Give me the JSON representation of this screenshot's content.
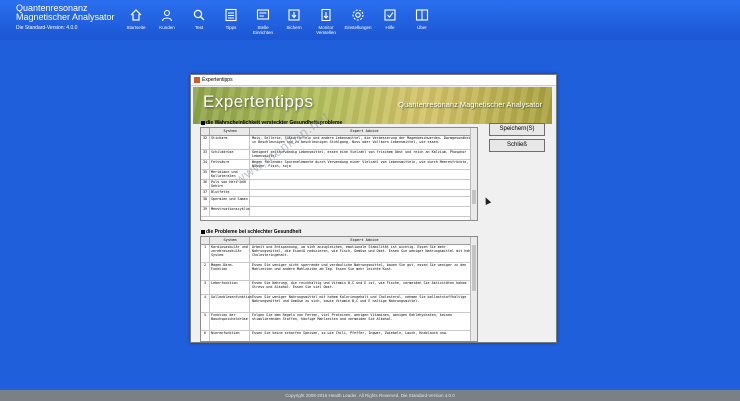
{
  "app": {
    "title_line1": "Quantenresonanz",
    "title_line2": "Magnetischer Analysator",
    "version": "Die Standard-Version: 4.0.0"
  },
  "toolbar": [
    {
      "label": "Startseite",
      "icon": "home-icon"
    },
    {
      "label": "Kunden",
      "icon": "person-icon"
    },
    {
      "label": "Test",
      "icon": "search-icon"
    },
    {
      "label": "Tipps",
      "icon": "list-icon"
    },
    {
      "label": "Stelle Einrichten",
      "icon": "settings-panel-icon"
    },
    {
      "label": "Sichern",
      "icon": "save-icon"
    },
    {
      "label": "Monitor Verstellen",
      "icon": "download-icon"
    },
    {
      "label": "Einstellungen",
      "icon": "gear-icon"
    },
    {
      "label": "Hilfe",
      "icon": "help-icon"
    },
    {
      "label": "Über",
      "icon": "about-icon"
    }
  ],
  "dialog": {
    "title": "Expertentipps",
    "banner_title": "Expertentipps",
    "banner_subtitle": "Quantenresonanz Magnetischer Analysator",
    "save_button": "Speichern(S)",
    "close_button": "Schließ"
  },
  "section1": {
    "title": "die Wahrscheinlichkeit versteckter Gesundheitsprobleme",
    "col_system": "System",
    "col_advice": "Expert Advice",
    "rows": [
      {
        "num": "32",
        "system": "Sticharm",
        "advice": "Mais, Sellerie, Süßkartoffeln und andere Lebensmittel, die Verbesserung der Magenbeschwerden. Darmgesundheit in Beschleunigen und zu beschleunigen Stuhlgang, Nuss oder Vollkorn Lebensmittel, wie essen."
      },
      {
        "num": "33",
        "system": "Schilddrüse",
        "advice": "Geeignet zeitaufwändig Lebensmittel, essen eine Vielzahl von frischem Obst und reich an Kalzium, Phosphor Lebensmittel"
      },
      {
        "num": "34",
        "system": "Fettsäure",
        "advice": "Wegen fehlender Spurenelemente durch Verwendung einer Vielzahl von Lebensmitteln, wie durch Meeresfrüchte, Nüssen, Fisch, soja"
      },
      {
        "num": "35",
        "system": "Meridiane und Kollateralen",
        "advice": ""
      },
      {
        "num": "36",
        "system": "Puls von Herz und Gehirn",
        "advice": ""
      },
      {
        "num": "37",
        "system": "Blutfette",
        "advice": ""
      },
      {
        "num": "38",
        "system": "Spermien und Samen",
        "advice": ""
      },
      {
        "num": "39",
        "system": "Menstruationszyklus",
        "advice": ""
      }
    ]
  },
  "section2": {
    "title": "die Probleme bei schlechter Gesundheit",
    "col_system": "System",
    "col_advice": "Expert Advice",
    "rows": [
      {
        "num": "1",
        "system": "Kardiovaskulär und zerebrovaskulär System",
        "advice": "Arbeit und Entspannung, um sich anzugleichen, emotionale Stabilität ist wichtig. Essen Sie mehr Nahrungsmittel, die Eiweiß reduzieren, wie Fisch, Gemüse und Obst. Essen Sie weniger Nahrungsmittel mit hohem Cholesteringehalt."
      },
      {
        "num": "2",
        "system": "Magen-Darm-Funktion",
        "advice": "Essen Sie weniger nicht sperrende und verdauliche Nahrungsmittel, bauen Sie gut, essen Sie weniger zu den Mahlzeiten und andere Mahlzeiten am Tag. Essen Sie mehr leichte Kost."
      },
      {
        "num": "3",
        "system": "Leberfunktion",
        "advice": "Essen Sie Nahrung, die reichhaltig und Vitamin B,C und E ist, wie Fische, vermeiden Sie Aktivitäten hohem Stress und Alkohol. Essen Sie viel Obst."
      },
      {
        "num": "4",
        "system": "Gallenblasenfunktion",
        "advice": "Essen Sie weniger Nahrungsmittel mit hohem Kaloriengehalt und Cholesterol, nehmen Sie ballaststoffhaltige Nahrungsmittel und Gemüse zu sich, sowie Vitamin B,C und E haltige Nahrungsmittel."
      },
      {
        "num": "5",
        "system": "Funktion der Bauchspeicheldrüse",
        "advice": "Folgen Sie dem Regeln von Fetten, viel Proteinen, wenigen Vitaminen, wenigen Kohlehydraten, keinen stimulierenden Stoffen, häufige Mahlzeiten und vermeiden Sie Alkohol."
      },
      {
        "num": "6",
        "system": "Nierenfunktion",
        "advice": "Essen Sie keine scharfen Speisen, so wie Chili, Pfeffer, Ingwer, Zwiebeln, Lauch, Knoblauch usw."
      }
    ]
  },
  "watermark": "www.monkon.net",
  "footer": "Copyright 2008-2016 Health Leader. All Rights Reserved. Die Standard-Version 4.0.0"
}
